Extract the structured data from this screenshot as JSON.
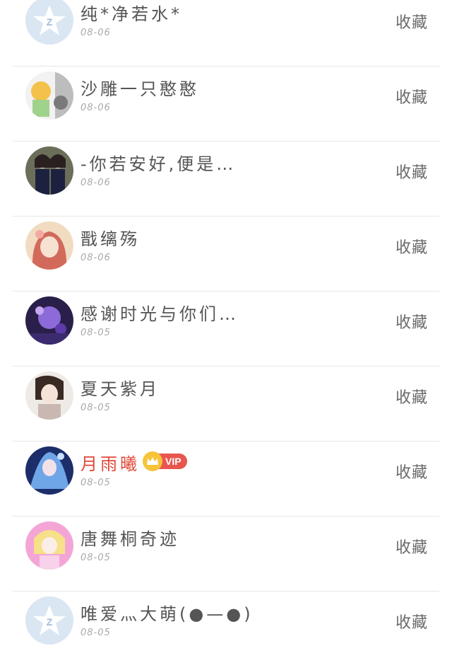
{
  "list": {
    "items": [
      {
        "name": "纯*净若水*",
        "date": "08-06",
        "action": "收藏",
        "avatar": "default-qq-avatar"
      },
      {
        "name": "沙雕一只憨憨",
        "date": "08-06",
        "action": "收藏",
        "avatar": "cartoon-avatar"
      },
      {
        "name": "-你若安好,便是…",
        "date": "08-06",
        "action": "收藏",
        "avatar": "two-girls-photo-avatar"
      },
      {
        "name": "戬缡殇",
        "date": "08-06",
        "action": "收藏",
        "avatar": "anime-girl-avatar"
      },
      {
        "name": "感谢时光与你们…",
        "date": "08-05",
        "action": "收藏",
        "avatar": "purple-fantasy-avatar"
      },
      {
        "name": "夏天紫月",
        "date": "08-05",
        "action": "收藏",
        "avatar": "ancient-style-girl-avatar"
      },
      {
        "name": "月雨曦",
        "date": "08-05",
        "action": "收藏",
        "avatar": "blue-anime-avatar",
        "vip": "VIP"
      },
      {
        "name": "唐舞桐奇迹",
        "date": "08-05",
        "action": "收藏",
        "avatar": "pink-anime-avatar"
      },
      {
        "name": "唯爱灬大萌(●—●)",
        "date": "08-05",
        "action": "收藏",
        "avatar": "default-qq-avatar"
      }
    ]
  },
  "colors": {
    "name": "#555555",
    "vip_name": "#e0483a",
    "date": "#a8a8a8",
    "action": "#6a6a6a",
    "divider": "#e6e6e6",
    "vip_badge": "#e8564d",
    "crown": "#f6c33a"
  }
}
